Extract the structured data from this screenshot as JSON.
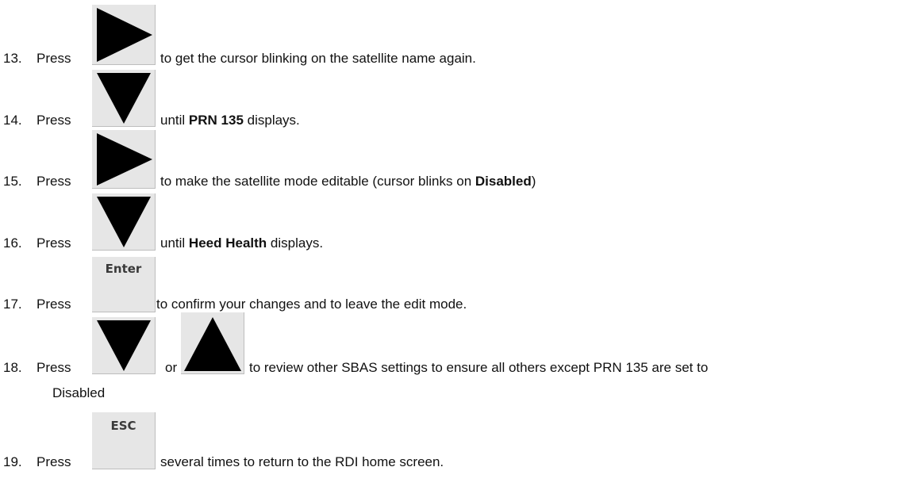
{
  "steps": [
    {
      "number": "13.",
      "press": "Press",
      "key": "right-arrow",
      "text": "to get the cursor blinking on the satellite name again."
    },
    {
      "number": "14.",
      "press": "Press",
      "key": "down-arrow",
      "text_before": "until ",
      "bold": "PRN 135",
      "text_after": " displays."
    },
    {
      "number": "15.",
      "press": "Press",
      "key": "right-arrow",
      "text_before": "to make the satellite mode editable (cursor blinks on ",
      "bold": "Disabled",
      "text_after": ")"
    },
    {
      "number": "16.",
      "press": "Press",
      "key": "down-arrow",
      "text_before": "until ",
      "bold": "Heed Health",
      "text_after": " displays."
    },
    {
      "number": "17.",
      "press": "Press",
      "key": "enter-key",
      "key_label": "Enter",
      "text": "to confirm your changes and to leave the edit mode."
    },
    {
      "number": "18.",
      "press": "Press",
      "key": "down-arrow",
      "or": "or",
      "key2": "up-arrow",
      "text": "to review other SBAS settings to ensure all others except PRN 135 are set to",
      "continuation": "Disabled"
    },
    {
      "number": "19.",
      "press": "Press",
      "key": "esc-key",
      "key_label": "ESC",
      "text": "several times to return to the RDI home screen."
    }
  ]
}
